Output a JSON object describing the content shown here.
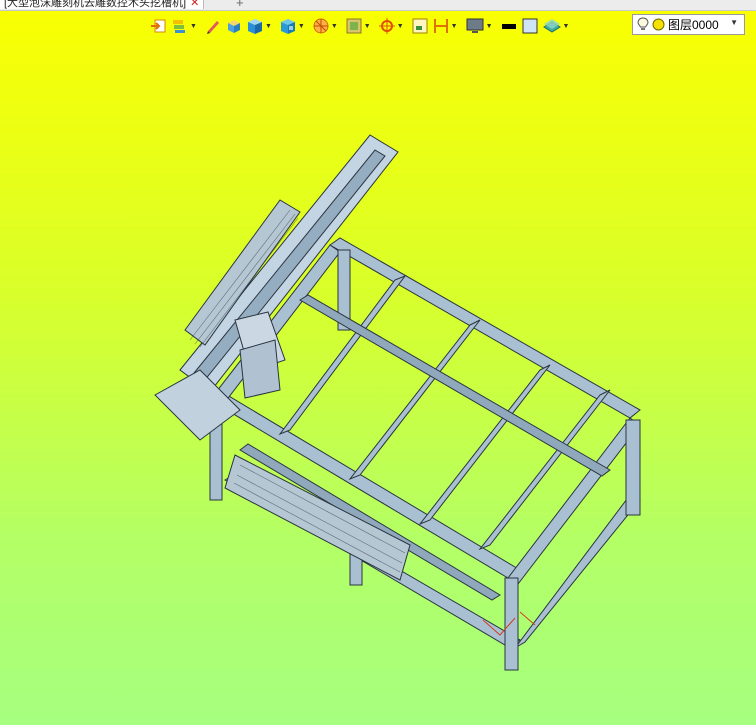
{
  "document_tab": {
    "title": "[大型泡沫雕刻机去雕数控木头挖槽机]",
    "close_icon": "close-icon",
    "new_tab_icon": "plus-icon"
  },
  "toolbar": {
    "tools": [
      {
        "icon": "import-icon",
        "has_dropdown": false
      },
      {
        "icon": "layers-stack-icon",
        "has_dropdown": true
      },
      {
        "icon": "pencil-icon",
        "has_dropdown": false
      },
      {
        "icon": "box-small-icon",
        "has_dropdown": false
      },
      {
        "icon": "box-blue-icon",
        "has_dropdown": true
      },
      {
        "icon": "view-cube-icon",
        "has_dropdown": true
      },
      {
        "icon": "render-sphere-icon",
        "has_dropdown": true
      },
      {
        "icon": "texture-icon",
        "has_dropdown": true
      },
      {
        "icon": "pivot-icon",
        "has_dropdown": true
      },
      {
        "icon": "frame-icon",
        "has_dropdown": false
      },
      {
        "icon": "dimension-icon",
        "has_dropdown": true
      },
      {
        "icon": "display-monitor-icon",
        "has_dropdown": true
      },
      {
        "icon": "line-color-swatch-icon",
        "has_dropdown": false
      },
      {
        "icon": "fill-color-swatch-icon",
        "has_dropdown": false
      },
      {
        "icon": "layer-plane-icon",
        "has_dropdown": true
      }
    ],
    "colors": {
      "line": "#000000",
      "fill": "#cfe4f7"
    }
  },
  "layer_selector": {
    "value": "图层0000",
    "bulb_icon": "lightbulb-icon",
    "status_icon": "yellow-dot-icon",
    "dropdown_icon": "chevron-down-icon"
  },
  "viewport": {
    "background_top": "#fbff00",
    "background_bottom": "#a6ff7f",
    "model_color": "#9fb6c8"
  }
}
